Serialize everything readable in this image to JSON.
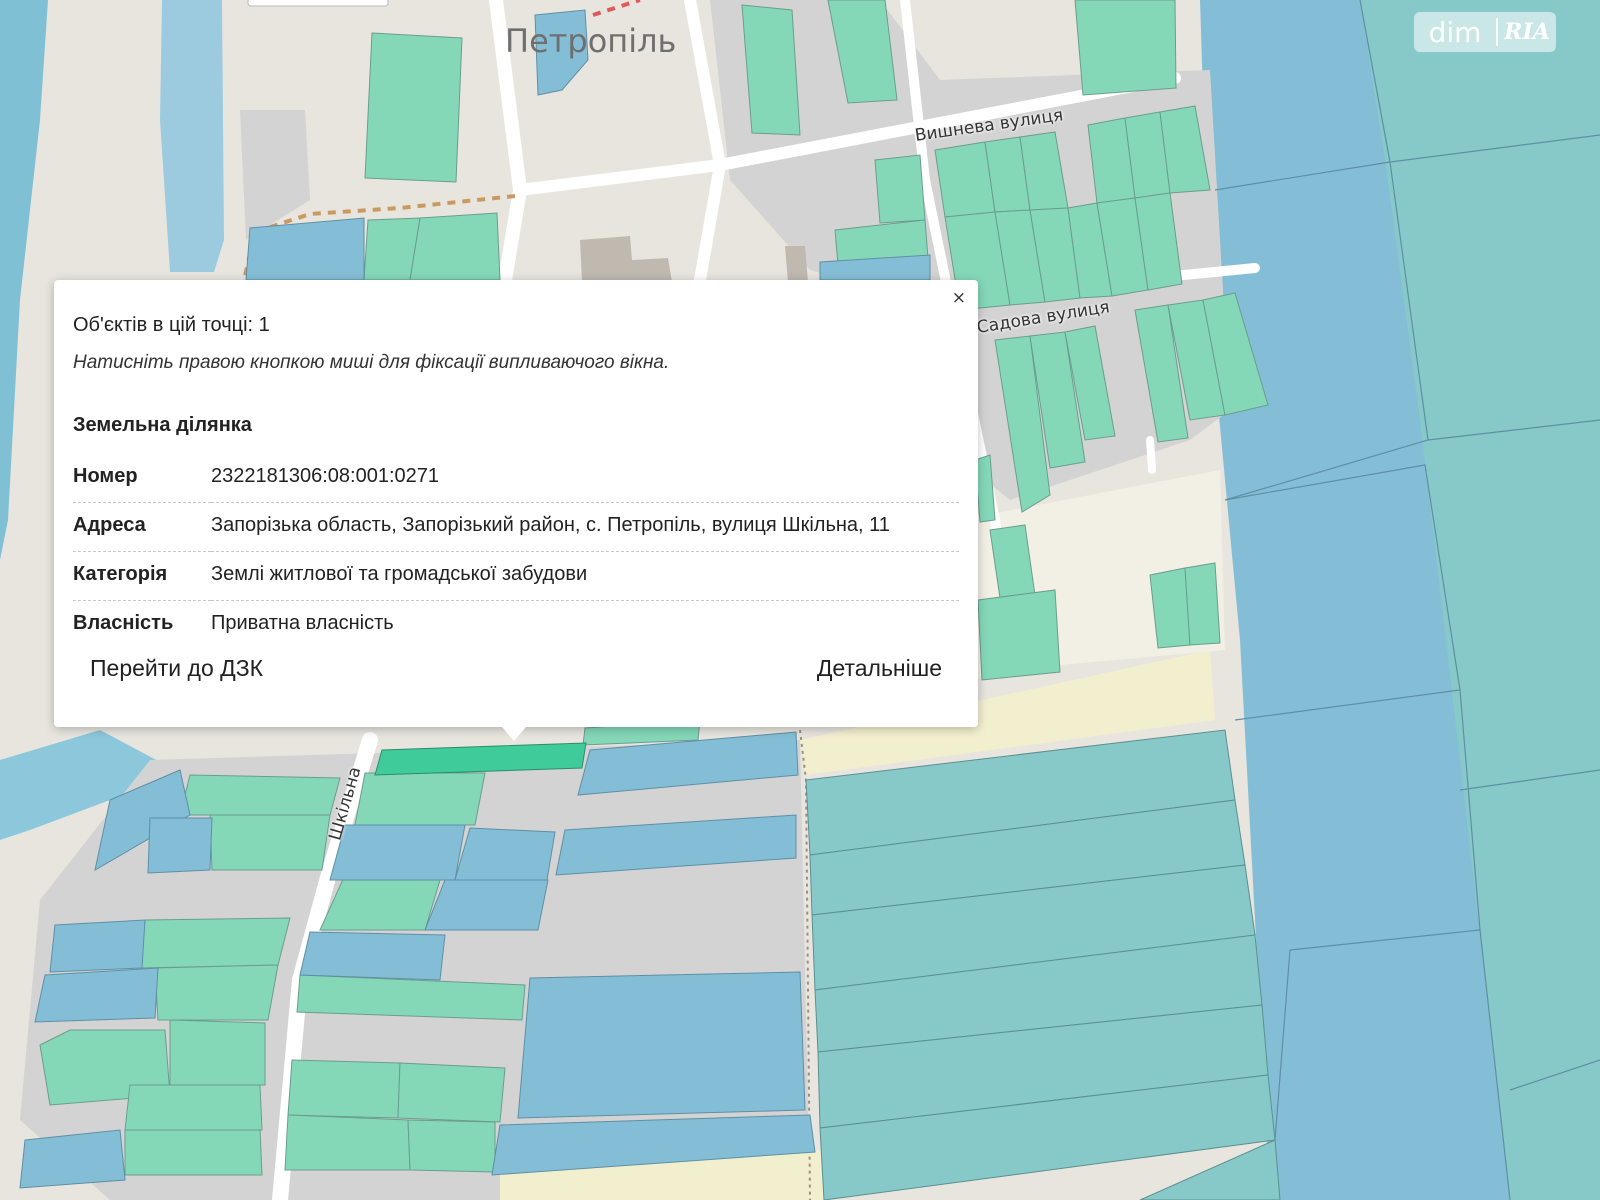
{
  "map": {
    "place_label": "Петропіль",
    "streets": [
      {
        "name": "Вишнева вулиця"
      },
      {
        "name": "Садова вулиця"
      },
      {
        "name": "Шкільна"
      }
    ],
    "colors": {
      "water": "#7fc0d4",
      "background": "#e8e5df",
      "road": "#ffffff",
      "built_area": "#d3d3d3",
      "parcel_green": "#84d8b8",
      "parcel_blue": "#84bed6",
      "parcel_teal": "#86c9c8",
      "selected_parcel": "#3fcc9a",
      "sand_area": "#f2efcf",
      "boundary_dashed": "#c89a5f"
    }
  },
  "watermark": {
    "left": "dim",
    "right": "RIA"
  },
  "popup": {
    "close_label": "×",
    "count_text": "Об'єктів в цій точці: 1",
    "hint_text": "Натисніть правою кнопкою миші для фіксації випливаючого вікна.",
    "section_title": "Земельна ділянка",
    "rows": [
      {
        "label": "Номер",
        "value": "2322181306:08:001:0271"
      },
      {
        "label": "Адреса",
        "value": "Запорізька область, Запорізький район, с. Петропіль, вулиця Шкільна, 11"
      },
      {
        "label": "Категорія",
        "value": "Землі житлової та громадської забудови"
      },
      {
        "label": "Власність",
        "value": "Приватна власність"
      }
    ],
    "button_dzk": "Перейти до ДЗК",
    "button_details": "Детальніше"
  }
}
